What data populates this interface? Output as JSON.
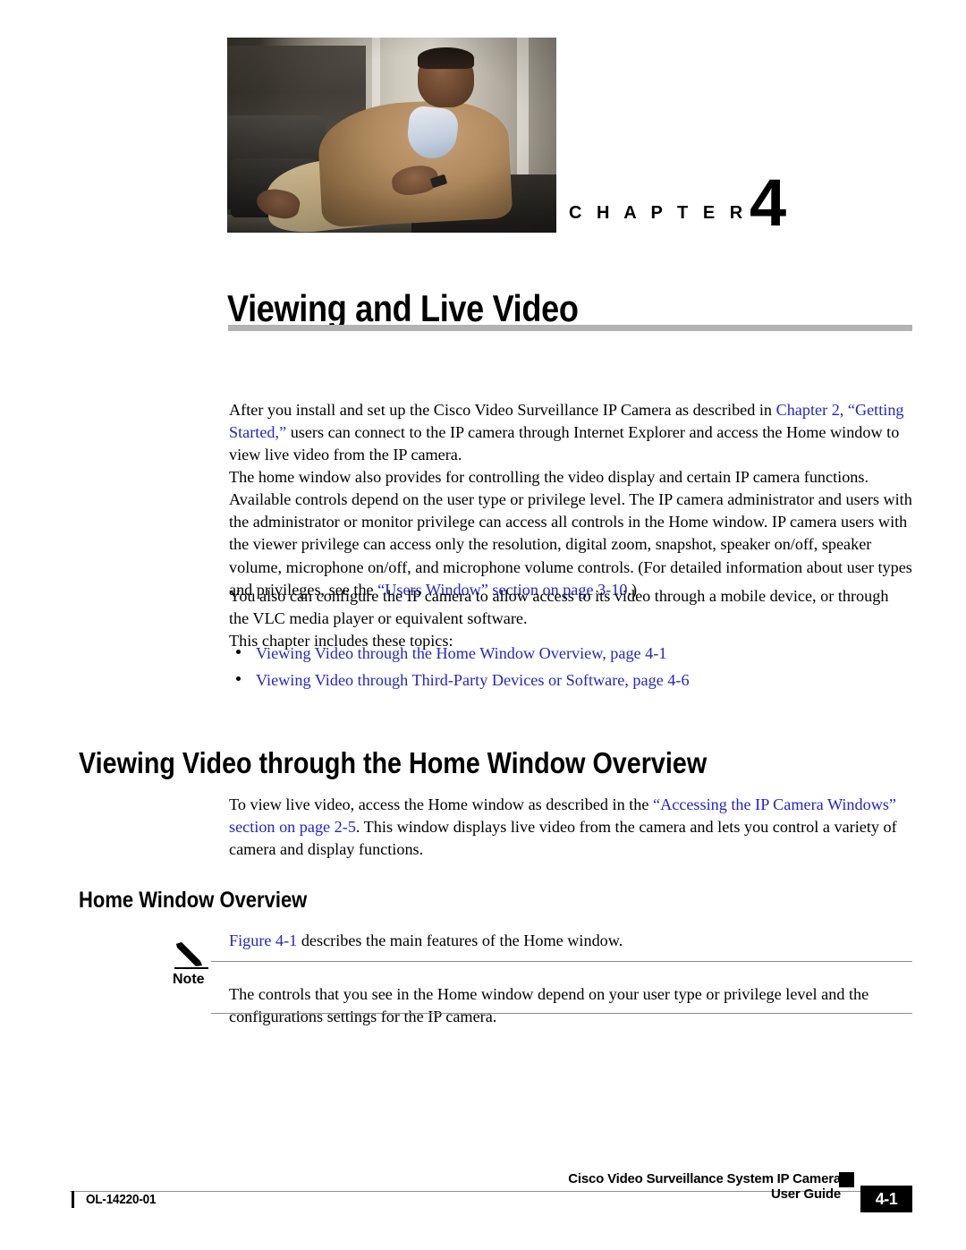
{
  "chapter": {
    "label": "C H A P T E R",
    "number": "4",
    "title": "Viewing and Live Video"
  },
  "intro": {
    "p1_a": "After you install and set up the Cisco Video Surveillance IP Camera as described in ",
    "p1_link": "Chapter 2, “Getting Started,”",
    "p1_b": " users can connect to the IP camera through Internet Explorer and access the Home window to view live video from the IP camera.",
    "p2_a": "The home window also provides for controlling the video display and certain IP camera functions. Available controls depend on the user type or privilege level. The IP camera administrator and users with the administrator or monitor privilege can access all controls in the Home window. IP camera users with the viewer privilege can access only the resolution, digital zoom, snapshot, speaker on/off, speaker volume, microphone on/off, and microphone volume controls. (For detailed information about user types and privileges, see the ",
    "p2_link": "“Users Window” section on page 3-10",
    "p2_b": ".)",
    "p3": "You also can configure the IP camera to allow access to its video through a mobile device, or through the VLC media player or equivalent software.",
    "p4": "This chapter includes these topics:"
  },
  "topics": [
    "Viewing Video through the Home Window Overview, page 4-1",
    "Viewing Video through Third-Party Devices or Software, page 4-6"
  ],
  "section": {
    "h1": "Viewing Video through the Home Window Overview",
    "p1_a": "To view live video, access the Home window as described in the ",
    "p1_link": "“Accessing the IP Camera Windows” section on page 2-5",
    "p1_b": ". This window displays live video from the camera and lets you control a variety of camera and display functions.",
    "h2": "Home Window Overview",
    "figure_link": "Figure 4-1",
    "figure_rest": " describes the main features of the Home window."
  },
  "note": {
    "label": "Note",
    "text": "The controls that you see in the Home window depend on your user type or privilege level and the configurations settings for the IP camera."
  },
  "footer": {
    "doc_id": "OL-14220-01",
    "guide_title": "Cisco Video Surveillance System IP Camera User Guide",
    "page_number": "4-1"
  },
  "colors": {
    "link": "#2424cc",
    "rule_gray": "#b3b3b3",
    "note_rule": "#8c8c8c"
  }
}
